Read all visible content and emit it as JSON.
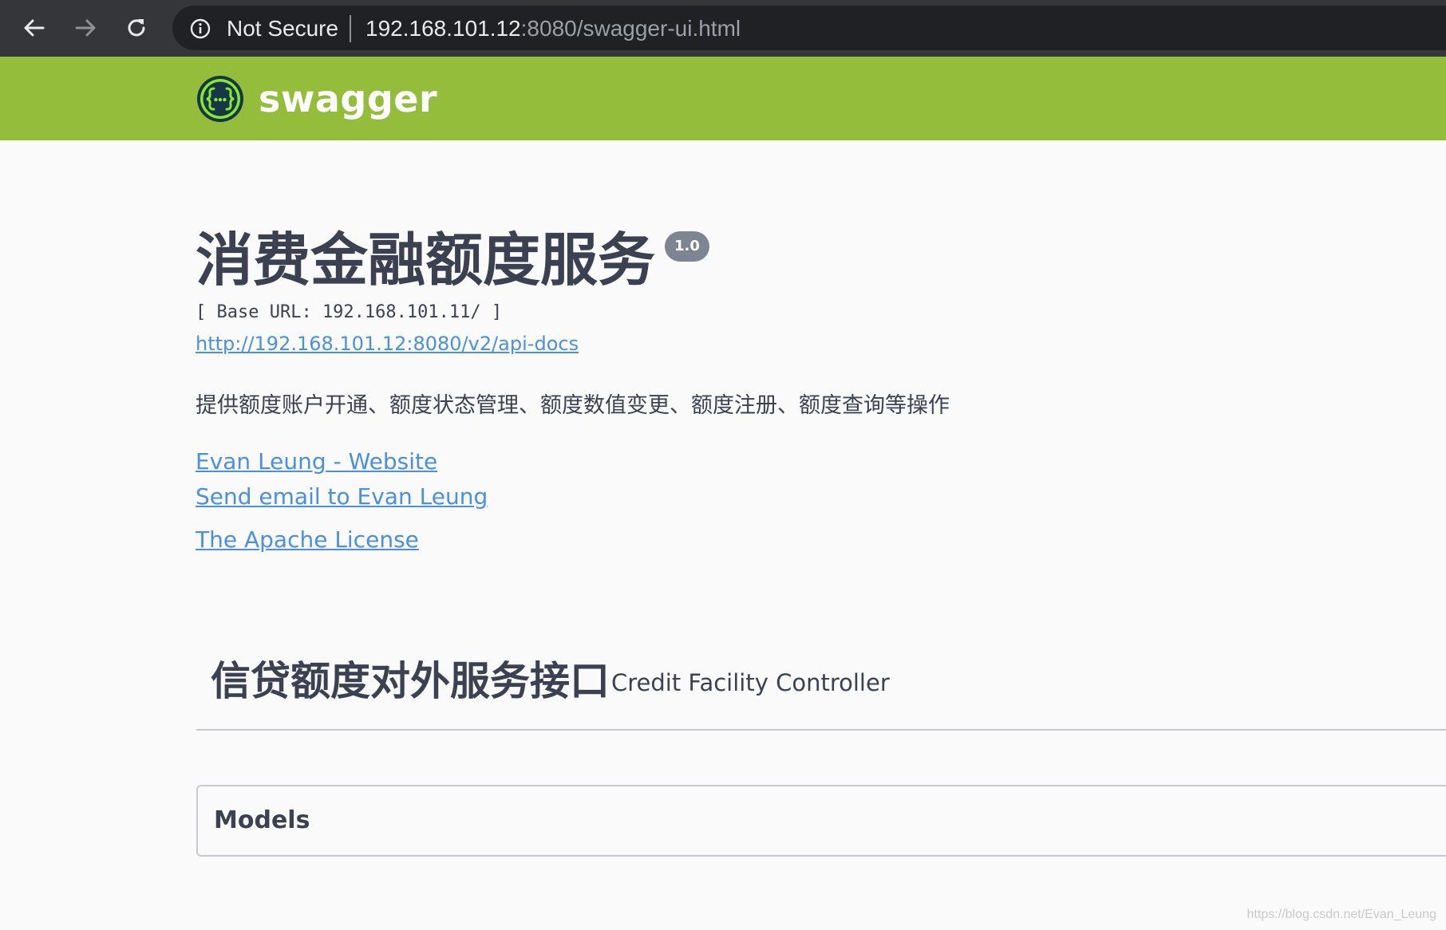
{
  "browser": {
    "security_label": "Not Secure",
    "url_host": "192.168.101.12",
    "url_path": ":8080/swagger-ui.html",
    "icons": {
      "back": "arrow-left-icon",
      "forward": "arrow-right-icon",
      "reload": "reload-icon",
      "security": "info-circle-icon"
    }
  },
  "topbar": {
    "brand": "swagger",
    "logo": "swagger-braces-icon",
    "color": "#93bd3b"
  },
  "info": {
    "title": "消费金融额度服务",
    "version": "1.0",
    "base_url": "[ Base URL: 192.168.101.11/ ]",
    "api_docs_link": "http://192.168.101.12:8080/v2/api-docs",
    "description": "提供额度账户开通、额度状态管理、额度数值变更、额度注册、额度查询等操作",
    "contact_website": "Evan Leung - Website",
    "contact_email": "Send email to Evan Leung",
    "license": "The Apache License"
  },
  "controller": {
    "name": "信贷额度对外服务接口",
    "description": "Credit Facility Controller"
  },
  "models": {
    "title": "Models"
  },
  "watermark": "https://blog.csdn.net/Evan_Leung"
}
